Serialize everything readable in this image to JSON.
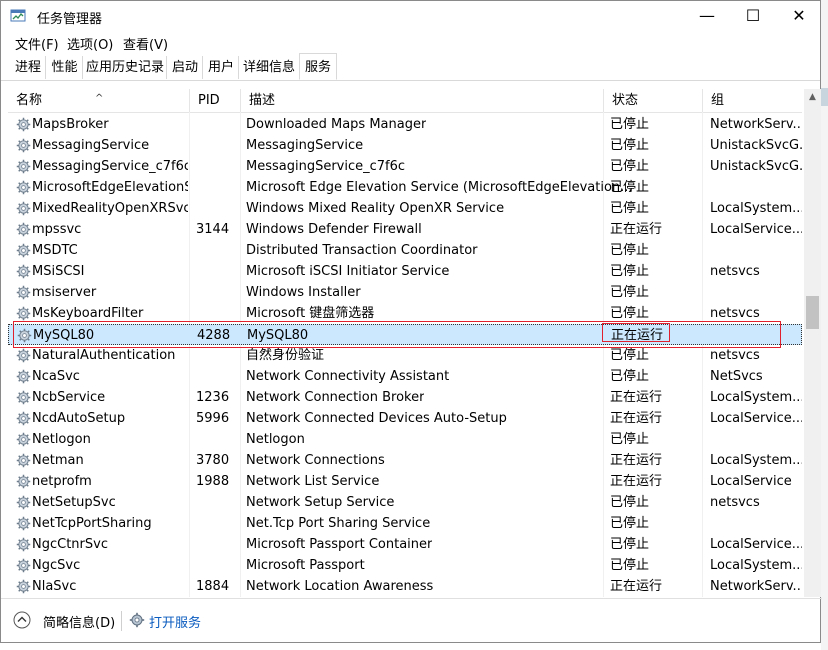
{
  "window": {
    "title": "任务管理器",
    "minimize": "—",
    "maximize": "☐",
    "close": "✕"
  },
  "menu": [
    "文件(F)",
    "选项(O)",
    "查看(V)"
  ],
  "tabs": [
    "进程",
    "性能",
    "应用历史记录",
    "启动",
    "用户",
    "详细信息",
    "服务"
  ],
  "active_tab": "服务",
  "columns": {
    "name": "名称",
    "pid": "PID",
    "desc": "描述",
    "status": "状态",
    "group": "组"
  },
  "services": [
    {
      "name": "MapsBroker",
      "pid": "",
      "desc": "Downloaded Maps Manager",
      "status": "已停止",
      "group": "NetworkServ..."
    },
    {
      "name": "MessagingService",
      "pid": "",
      "desc": "MessagingService",
      "status": "已停止",
      "group": "UnistackSvcG..."
    },
    {
      "name": "MessagingService_c7f6c",
      "pid": "",
      "desc": "MessagingService_c7f6c",
      "status": "已停止",
      "group": "UnistackSvcG..."
    },
    {
      "name": "MicrosoftEdgeElevationS...",
      "pid": "",
      "desc": "Microsoft Edge Elevation Service (MicrosoftEdgeElevation...",
      "status": "已停止",
      "group": ""
    },
    {
      "name": "MixedRealityOpenXRSvc",
      "pid": "",
      "desc": "Windows Mixed Reality OpenXR Service",
      "status": "已停止",
      "group": "LocalSystem..."
    },
    {
      "name": "mpssvc",
      "pid": "3144",
      "desc": "Windows Defender Firewall",
      "status": "正在运行",
      "group": "LocalService..."
    },
    {
      "name": "MSDTC",
      "pid": "",
      "desc": "Distributed Transaction Coordinator",
      "status": "已停止",
      "group": ""
    },
    {
      "name": "MSiSCSI",
      "pid": "",
      "desc": "Microsoft iSCSI Initiator Service",
      "status": "已停止",
      "group": "netsvcs"
    },
    {
      "name": "msiserver",
      "pid": "",
      "desc": "Windows Installer",
      "status": "已停止",
      "group": ""
    },
    {
      "name": "MsKeyboardFilter",
      "pid": "",
      "desc": "Microsoft 键盘筛选器",
      "status": "已停止",
      "group": "netsvcs"
    },
    {
      "name": "MySQL80",
      "pid": "4288",
      "desc": "MySQL80",
      "status": "正在运行",
      "group": ""
    },
    {
      "name": "NaturalAuthentication",
      "pid": "",
      "desc": "自然身份验证",
      "status": "已停止",
      "group": "netsvcs"
    },
    {
      "name": "NcaSvc",
      "pid": "",
      "desc": "Network Connectivity Assistant",
      "status": "已停止",
      "group": "NetSvcs"
    },
    {
      "name": "NcbService",
      "pid": "1236",
      "desc": "Network Connection Broker",
      "status": "正在运行",
      "group": "LocalSystem..."
    },
    {
      "name": "NcdAutoSetup",
      "pid": "5996",
      "desc": "Network Connected Devices Auto-Setup",
      "status": "正在运行",
      "group": "LocalService..."
    },
    {
      "name": "Netlogon",
      "pid": "",
      "desc": "Netlogon",
      "status": "已停止",
      "group": ""
    },
    {
      "name": "Netman",
      "pid": "3780",
      "desc": "Network Connections",
      "status": "正在运行",
      "group": "LocalSystem..."
    },
    {
      "name": "netprofm",
      "pid": "1988",
      "desc": "Network List Service",
      "status": "正在运行",
      "group": "LocalService"
    },
    {
      "name": "NetSetupSvc",
      "pid": "",
      "desc": "Network Setup Service",
      "status": "已停止",
      "group": "netsvcs"
    },
    {
      "name": "NetTcpPortSharing",
      "pid": "",
      "desc": "Net.Tcp Port Sharing Service",
      "status": "已停止",
      "group": ""
    },
    {
      "name": "NgcCtnrSvc",
      "pid": "",
      "desc": "Microsoft Passport Container",
      "status": "已停止",
      "group": "LocalService..."
    },
    {
      "name": "NgcSvc",
      "pid": "",
      "desc": "Microsoft Passport",
      "status": "已停止",
      "group": "LocalSystem..."
    },
    {
      "name": "NlaSvc",
      "pid": "1884",
      "desc": "Network Location Awareness",
      "status": "正在运行",
      "group": "NetworkServ..."
    }
  ],
  "selected_service": "MySQL80",
  "footer": {
    "fewer_details": "简略信息(D)",
    "open_services": "打开服务"
  },
  "colors": {
    "selection": "#cce8ff",
    "highlight": "#e0202c",
    "link": "#0a5bbf"
  }
}
